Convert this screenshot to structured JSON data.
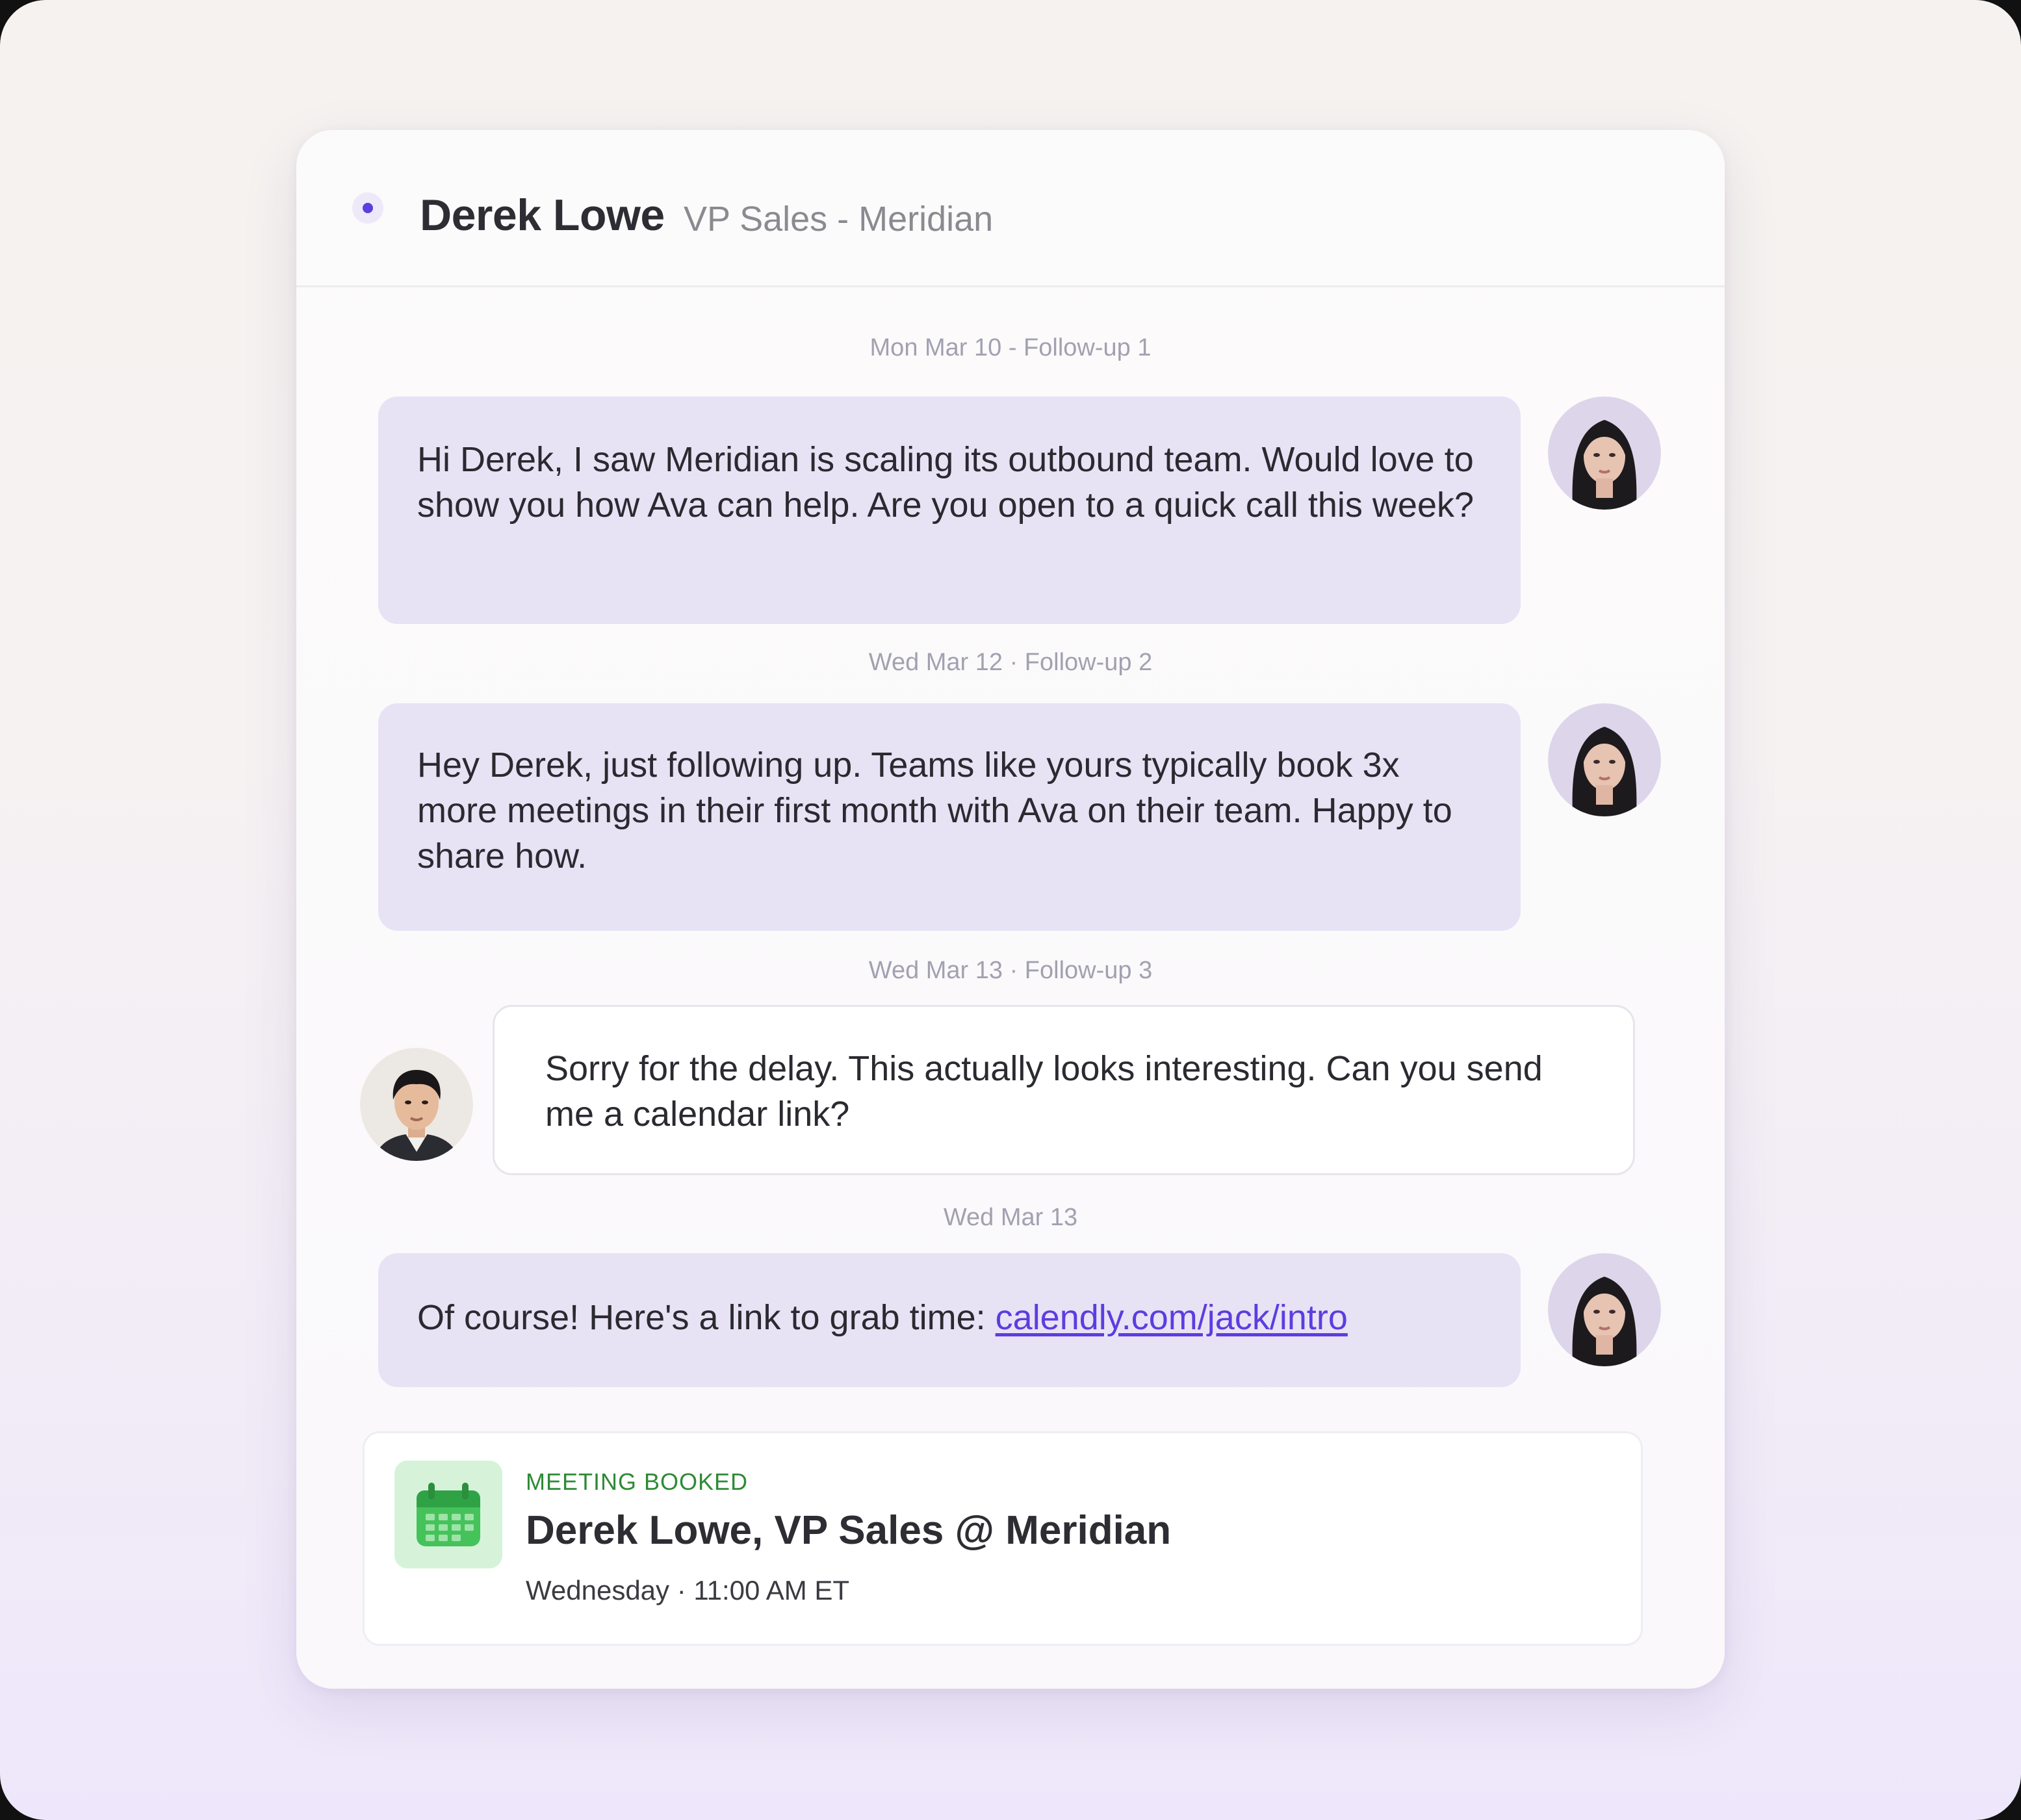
{
  "header": {
    "name": "Derek Lowe",
    "role": "VP Sales - Meridian"
  },
  "messages": [
    {
      "date_label": "Mon Mar 10 - Follow-up 1",
      "direction": "outgoing",
      "text": "Hi Derek, I saw Meridian is scaling its outbound team. Would love to show you how Ava can help. Are you open to a quick call this week?"
    },
    {
      "date_label": "Wed Mar 12 · Follow-up 2",
      "direction": "outgoing",
      "text": "Hey Derek, just following up. Teams like yours typically book 3x more meetings in their first month with Ava on their team. Happy to share how."
    },
    {
      "date_label": "Wed Mar 13 · Follow-up 3",
      "direction": "incoming",
      "text": "Sorry for the delay. This actually looks interesting. Can you send me a calendar link?"
    },
    {
      "date_label": "Wed Mar 13",
      "direction": "outgoing",
      "text": "Of course! Here's a link to grab time: ",
      "link": "calendly.com/jack/intro"
    }
  ],
  "meeting": {
    "status": "MEETING BOOKED",
    "title": "Derek Lowe, VP Sales @ Meridian",
    "time": "Wednesday · 11:00 AM ET",
    "icon": "calendar-icon"
  },
  "colors": {
    "accent": "#5b3fe0",
    "outgoing_bubble": "#e8e2f5",
    "incoming_bubble": "#ffffff",
    "meeting_green": "#2f8a35",
    "link": "#5a3ee0"
  }
}
